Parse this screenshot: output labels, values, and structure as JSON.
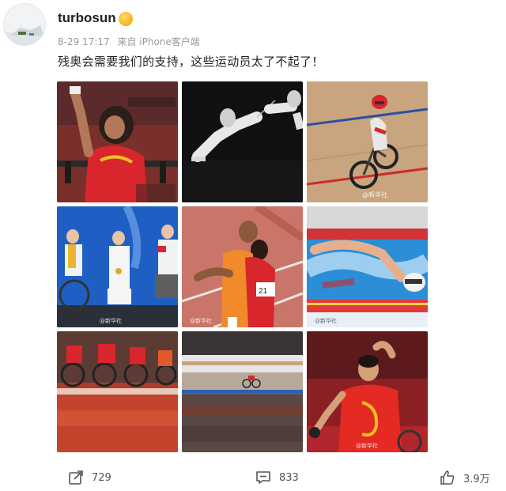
{
  "post": {
    "username": "turbosun",
    "timestamp": "8-29 17:17",
    "source": "来自 iPhone客户端",
    "text": "残奥会需要我们的支持，这些运动员太了不起了！"
  },
  "images": [
    {
      "subject": "weightlifter-celebrating",
      "watermark": ""
    },
    {
      "subject": "fencing",
      "watermark": ""
    },
    {
      "subject": "track-cycling",
      "watermark": "@新华社"
    },
    {
      "subject": "medal-ceremony",
      "watermark": "@新华社"
    },
    {
      "subject": "runner-and-guide",
      "watermark": "@新华社"
    },
    {
      "subject": "swimmer",
      "watermark": "@新华社"
    },
    {
      "subject": "wheelchair-basketball",
      "watermark": ""
    },
    {
      "subject": "cycling-blur",
      "watermark": ""
    },
    {
      "subject": "table-tennis-celebration",
      "watermark": "@新华社"
    }
  ],
  "actions": {
    "share_count": "729",
    "comment_count": "833",
    "like_count": "3.9万"
  },
  "colors": {
    "accent_red": "#d8262c",
    "text_gray": "#9a9a9a"
  }
}
